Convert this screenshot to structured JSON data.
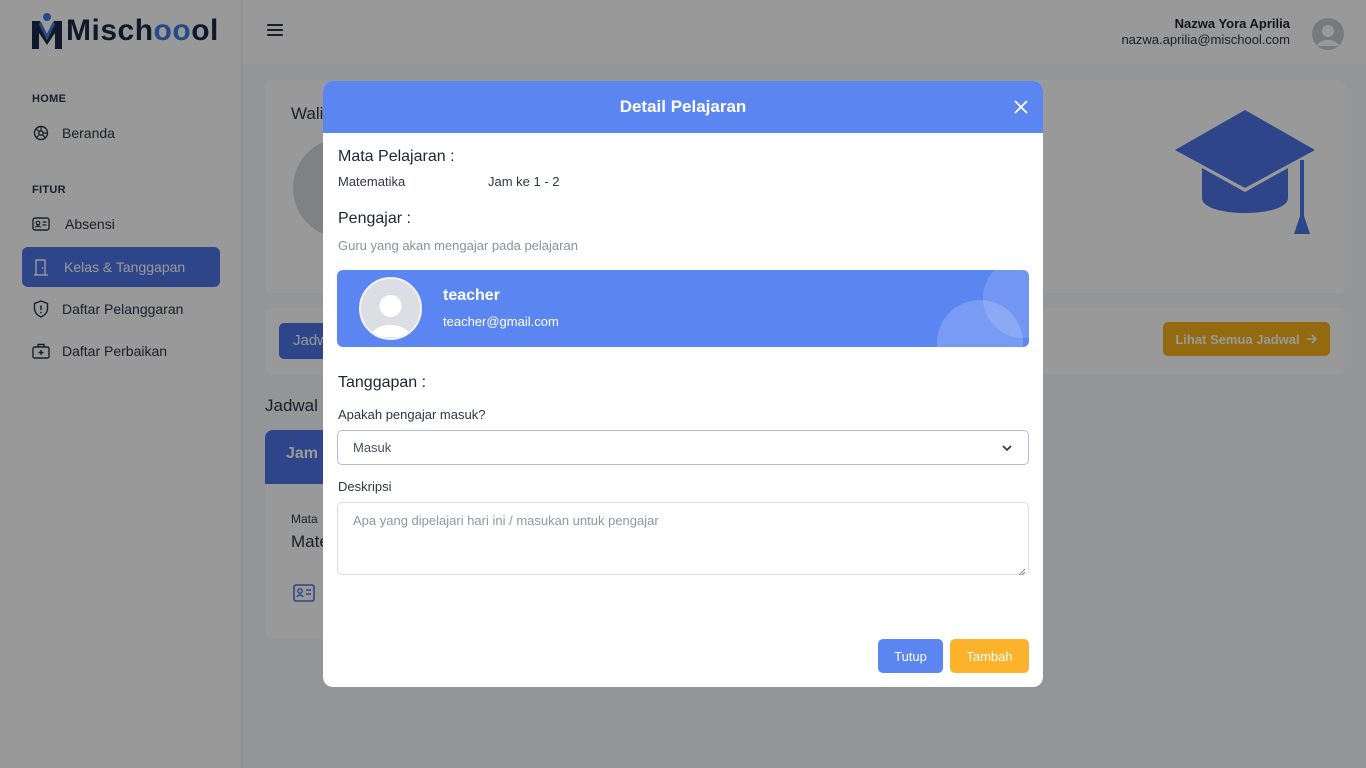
{
  "app": {
    "logo_text_a": "Misch",
    "logo_text_b": "ol"
  },
  "sidebar": {
    "sections": [
      {
        "label": "HOME"
      },
      {
        "label": "FITUR"
      }
    ],
    "items": [
      {
        "label": "Beranda",
        "icon": "dashboard-icon"
      },
      {
        "label": "Absensi",
        "icon": "id-card-icon"
      },
      {
        "label": "Kelas & Tanggapan",
        "icon": "door-icon",
        "active": true
      },
      {
        "label": "Daftar Pelanggaran",
        "icon": "shield-icon"
      },
      {
        "label": "Daftar Perbaikan",
        "icon": "medkit-icon"
      }
    ]
  },
  "topbar": {
    "user_name": "Nazwa Yora Aprilia",
    "user_email": "nazwa.aprilia@mischool.com"
  },
  "background": {
    "wali_text": "Wali",
    "jadwal_button": "Jadw",
    "lihat_button": "Lihat Semua Jadwal",
    "section_title": "Jadwal P",
    "schedule_head": "Jam k",
    "schedule_label": "Mata",
    "schedule_value": "Mate"
  },
  "modal": {
    "title": "Detail Pelajaran",
    "mapel_label": "Mata Pelajaran :",
    "mapel_value": "Matematika",
    "jam_value": "Jam ke 1 - 2",
    "pengajar_label": "Pengajar :",
    "pengajar_desc": "Guru yang akan mengajar pada pelajaran",
    "teacher": {
      "name": "teacher",
      "email": "teacher@gmail.com"
    },
    "tanggapan_label": "Tanggapan :",
    "question_label": "Apakah pengajar masuk?",
    "select_value": "Masuk",
    "deskripsi_label": "Deskripsi",
    "deskripsi_placeholder": "Apa yang dipelajari hari ini / masukan untuk pengajar",
    "btn_close": "Tutup",
    "btn_add": "Tambah"
  },
  "colors": {
    "primary": "#5b86f1",
    "sidebar_active": "#4f74e6",
    "accent": "#fcb32b"
  }
}
